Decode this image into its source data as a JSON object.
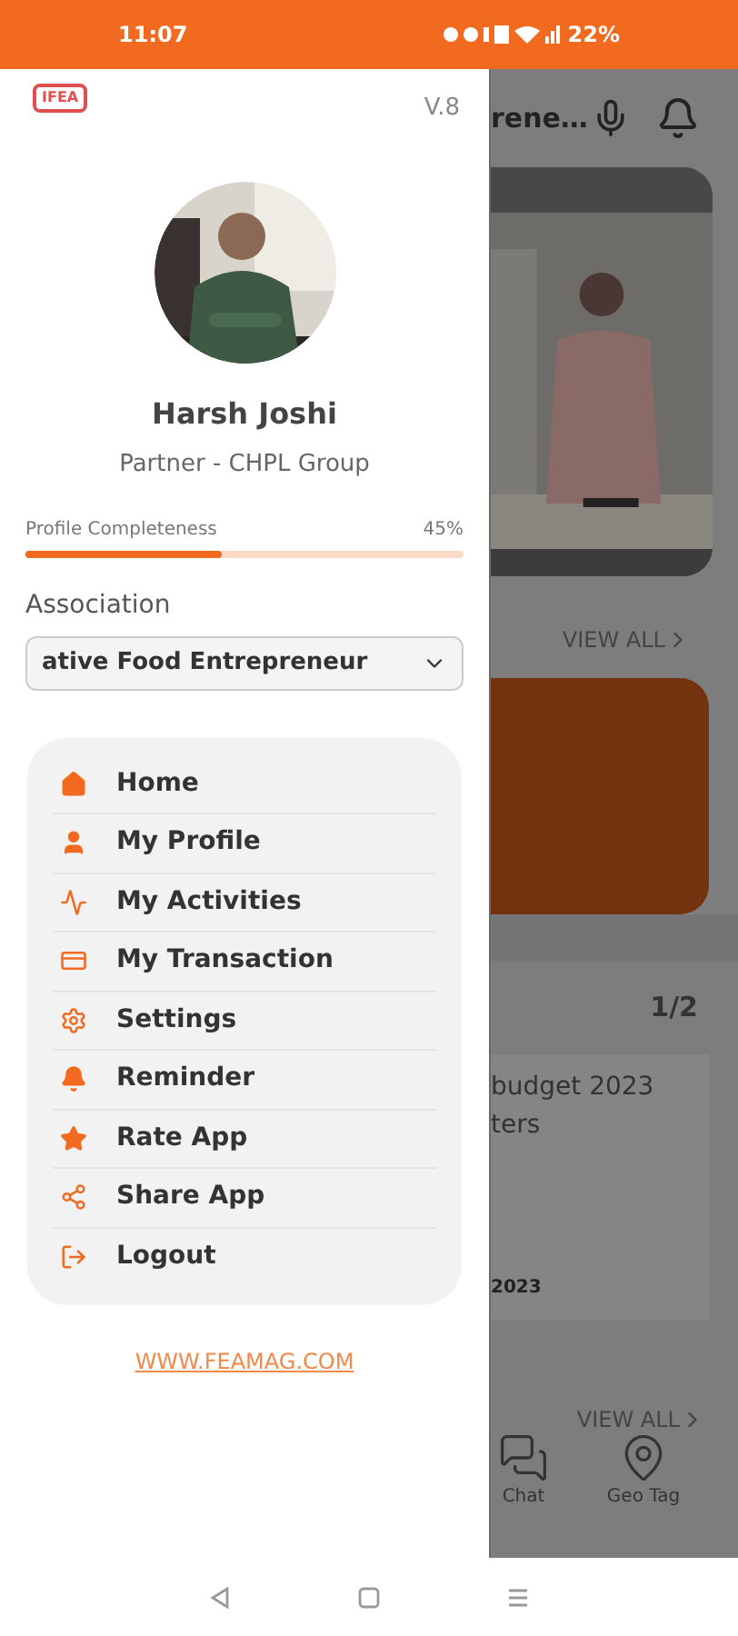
{
  "status_bar": {
    "time": "11:07",
    "battery": "22%"
  },
  "drawer": {
    "logo": "IFEA",
    "version": "V.8",
    "profile": {
      "name": "Harsh Joshi",
      "role": "Partner - CHPL Group"
    },
    "completeness": {
      "label": "Profile Completeness",
      "percent": "45%",
      "level": 0.45
    },
    "association": {
      "label": "Association",
      "value": "ative Food Entrepreneur"
    },
    "menu": [
      {
        "kind": "home",
        "label": "Home"
      },
      {
        "kind": "profile",
        "label": "My Profile"
      },
      {
        "kind": "activity",
        "label": "My Activities"
      },
      {
        "kind": "transaction",
        "label": "My Transaction"
      },
      {
        "kind": "settings",
        "label": "Settings"
      },
      {
        "kind": "reminder",
        "label": "Reminder"
      },
      {
        "kind": "rate",
        "label": "Rate App"
      },
      {
        "kind": "share",
        "label": "Share App"
      },
      {
        "kind": "logout",
        "label": "Logout"
      }
    ],
    "website": "WWW.FEAMAG.COM"
  },
  "background": {
    "header_title": "rene…",
    "view_all_top": "VIEW ALL",
    "counter": "1/2",
    "news_title": [
      "budget 2023",
      "ters"
    ],
    "news_date": "2023",
    "view_all_bottom": "VIEW ALL",
    "bottom_nav": [
      {
        "kind": "chat",
        "label": "Chat"
      },
      {
        "kind": "geo",
        "label": "Geo Tag"
      }
    ]
  }
}
